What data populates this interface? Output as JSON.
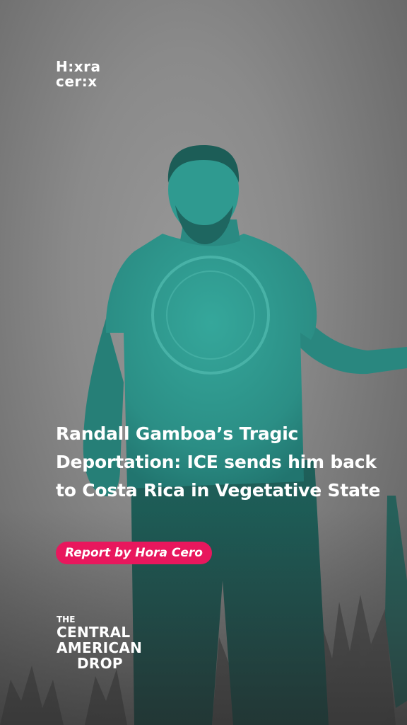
{
  "top_logo": {
    "line1": "H:xra",
    "line2": "cer:x"
  },
  "headline": "Randall Gamboa’s Tragic Deportation: ICE sends him back to Costa Rica in Vegetative State",
  "badge": "Report by Hora Cero",
  "bottom_logo": {
    "line1": "THE",
    "line2": "CENTRAL",
    "line3": "AMERICAN",
    "line4": "DROP"
  },
  "photo": {
    "subject": "man-in-teal-tshirt",
    "tint_color": "#2f9b91",
    "background_tone": "#808080"
  },
  "colors": {
    "badge": "#e8175d",
    "text": "#ffffff"
  }
}
